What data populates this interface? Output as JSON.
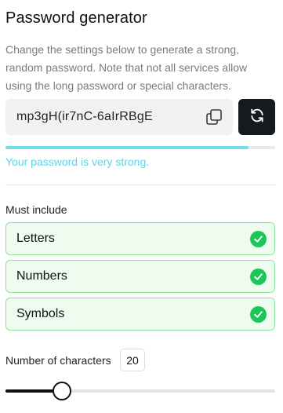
{
  "title": "Password generator",
  "description": "Change the settings below to generate a strong, random password. Note that not all services allow using the long password or special characters.",
  "password": {
    "value": "mp3gH(ir7nC-6aIrRBgE",
    "copy_icon": "copy-icon",
    "refresh_icon": "refresh-icon"
  },
  "strength": {
    "level": 0.9,
    "text": "Your password is very strong.",
    "color": "#5fd4ea"
  },
  "must_include": {
    "label": "Must include",
    "options": [
      {
        "label": "Letters",
        "checked": true
      },
      {
        "label": "Numbers",
        "checked": true
      },
      {
        "label": "Symbols",
        "checked": true
      }
    ]
  },
  "length": {
    "label": "Number of characters",
    "value": "20",
    "slider_fraction": 0.21
  },
  "colors": {
    "accent_dark": "#151a1d",
    "check_green": "#1ec659",
    "option_bg": "#eefcef",
    "option_border": "#8de39a"
  }
}
